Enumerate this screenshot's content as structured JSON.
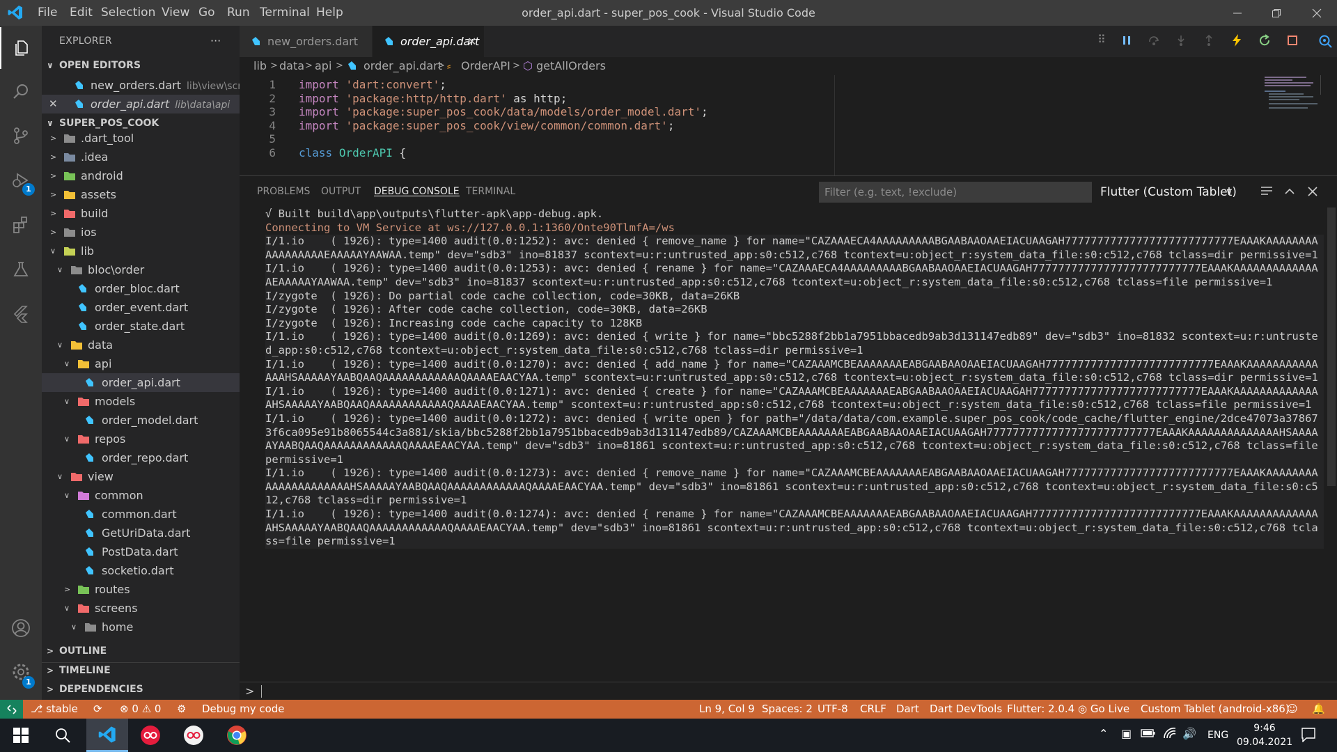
{
  "window": {
    "title": "order_api.dart - super_pos_cook - Visual Studio Code",
    "menu": [
      "File",
      "Edit",
      "Selection",
      "View",
      "Go",
      "Run",
      "Terminal",
      "Help"
    ]
  },
  "activity_bar": {
    "debug_badge": "1",
    "settings_badge": "1"
  },
  "sidebar": {
    "title": "EXPLORER",
    "more": "···",
    "open_editors_label": "OPEN EDITORS",
    "open_editors": [
      {
        "name": "new_orders.dart",
        "path": "lib\\view\\scr..."
      },
      {
        "name": "order_api.dart",
        "path": "lib\\data\\api"
      }
    ],
    "project_label": "SUPER_POS_COOK",
    "tree": [
      {
        "name": ".dart_tool"
      },
      {
        "name": ".idea"
      },
      {
        "name": "android"
      },
      {
        "name": "assets"
      },
      {
        "name": "build"
      },
      {
        "name": "ios"
      },
      {
        "name": "lib"
      },
      {
        "name": "bloc\\order"
      },
      {
        "name": "order_bloc.dart"
      },
      {
        "name": "order_event.dart"
      },
      {
        "name": "order_state.dart"
      },
      {
        "name": "data"
      },
      {
        "name": "api"
      },
      {
        "name": "order_api.dart"
      },
      {
        "name": "models"
      },
      {
        "name": "order_model.dart"
      },
      {
        "name": "repos"
      },
      {
        "name": "order_repo.dart"
      },
      {
        "name": "view"
      },
      {
        "name": "common"
      },
      {
        "name": "common.dart"
      },
      {
        "name": "GetUriData.dart"
      },
      {
        "name": "PostData.dart"
      },
      {
        "name": "socketio.dart"
      },
      {
        "name": "routes"
      },
      {
        "name": "screens"
      },
      {
        "name": "home"
      }
    ],
    "outline_label": "OUTLINE",
    "timeline_label": "TIMELINE",
    "dependencies_label": "DEPENDENCIES"
  },
  "tabs": [
    {
      "label": "new_orders.dart"
    },
    {
      "label": "order_api.dart"
    }
  ],
  "breadcrumb": [
    "lib",
    "data",
    "api",
    "order_api.dart",
    "OrderAPI",
    "getAllOrders"
  ],
  "editor": {
    "lines": [
      {
        "num": "1",
        "kw": "import",
        "str": "'dart:convert'",
        "rest": ";"
      },
      {
        "num": "2",
        "kw": "import",
        "str": "'package:http/http.dart'",
        "rest": " as http;"
      },
      {
        "num": "3",
        "kw": "import",
        "str": "'package:super_pos_cook/data/models/order_model.dart'",
        "rest": ";"
      },
      {
        "num": "4",
        "kw": "import",
        "str": "'package:super_pos_cook/view/common/common.dart'",
        "rest": ";"
      },
      {
        "num": "5",
        "kw": "",
        "str": "",
        "rest": ""
      },
      {
        "num": "6",
        "kw": "class",
        "str": "OrderAPI",
        "rest": " {"
      }
    ]
  },
  "panel": {
    "tabs": [
      "PROBLEMS",
      "OUTPUT",
      "DEBUG CONSOLE",
      "TERMINAL"
    ],
    "filter_placeholder": "Filter (e.g. text, !exclude)",
    "debug_target": "Flutter (Custom Tablet)",
    "prompt": ">",
    "console": [
      "√ Built build\\app\\outputs\\flutter-apk\\app-debug.apk.",
      "Connecting to VM Service at ws://127.0.0.1:1360/Onte90TlmfA=/ws",
      "I/1.io    ( 1926): type=1400 audit(0.0:1252): avc: denied { remove_name } for name=\"CAZAAAECA4AAAAAAAAABGAABAAOAAEIACUAAGAH77777777777777777777777777EAAAKAAAAAAAAAAAAAAAAAEAAAAAYAAWAA.temp\" dev=\"sdb3\" ino=81837 scontext=u:r:untrusted_app:s0:c512,c768 tcontext=u:object_r:system_data_file:s0:c512,c768 tclass=dir permissive=1",
      "I/1.io    ( 1926): type=1400 audit(0.0:1253): avc: denied { rename } for name=\"CAZAAAECA4AAAAAAAAABGAABAAOAAEIACUAAGAH77777777777777777777777777EAAAKAAAAAAAAAAAAAAEAAAAAYAAWAA.temp\" dev=\"sdb3\" ino=81837 scontext=u:r:untrusted_app:s0:c512,c768 tcontext=u:object_r:system_data_file:s0:c512,c768 tclass=file permissive=1",
      "I/zygote  ( 1926): Do partial code cache collection, code=30KB, data=26KB",
      "I/zygote  ( 1926): After code cache collection, code=30KB, data=26KB",
      "I/zygote  ( 1926): Increasing code cache capacity to 128KB",
      "I/1.io    ( 1926): type=1400 audit(0.0:1269): avc: denied { write } for name=\"bbc5288f2bb1a7951bbacedb9ab3d131147edb89\" dev=\"sdb3\" ino=81832 scontext=u:r:untrusted_app:s0:c512,c768 tcontext=u:object_r:system_data_file:s0:c512,c768 tclass=dir permissive=1",
      "I/1.io    ( 1926): type=1400 audit(0.0:1270): avc: denied { add_name } for name=\"CAZAAAMCBEAAAAAAAEABGAABAAOAAEIACUAAGAH77777777777777777777777777EAAAKAAAAAAAAAAAAAAHSAAAAAYAABQAAQAAAAAAAAAAAAQAAAAEAACYAA.temp\" scontext=u:r:untrusted_app:s0:c512,c768 tcontext=u:object_r:system_data_file:s0:c512,c768 tclass=dir permissive=1",
      "I/1.io    ( 1926): type=1400 audit(0.0:1271): avc: denied { create } for name=\"CAZAAAMCBEAAAAAAAEABGAABAAOAAEIACUAAGAH77777777777777777777777777EAAAKAAAAAAAAAAAAAAHSAAAAAYAABQAAQAAAAAAAAAAAAQAAAAEAACYAA.temp\" scontext=u:r:untrusted_app:s0:c512,c768 tcontext=u:object_r:system_data_file:s0:c512,c768 tclass=file permissive=1",
      "I/1.io    ( 1926): type=1400 audit(0.0:1272): avc: denied { write open } for path=\"/data/data/com.example.super_pos_cook/code_cache/flutter_engine/2dce47073a378673f6ca095e91b8065544c3a881/skia/bbc5288f2bb1a7951bbacedb9ab3d131147edb89/CAZAAAMCBEAAAAAAAEABGAABAAOAAEIACUAAGAH77777777777777777777777777EAAAKAAAAAAAAAAAAAAHSAAAAAYAABQAAQAAAAAAAAAAAAQAAAAEAACYAA.temp\" dev=\"sdb3\" ino=81861 scontext=u:r:untrusted_app:s0:c512,c768 tcontext=u:object_r:system_data_file:s0:c512,c768 tclass=file permissive=1",
      "I/1.io    ( 1926): type=1400 audit(0.0:1273): avc: denied { remove_name } for name=\"CAZAAAMCBEAAAAAAAEABGAABAAOAAEIACUAAGAH77777777777777777777777777EAAAKAAAAAAAAAAAAAAAAAAAAAHSAAAAAYAABQAAQAAAAAAAAAAAAQAAAAEAACYAA.temp\" dev=\"sdb3\" ino=81861 scontext=u:r:untrusted_app:s0:c512,c768 tcontext=u:object_r:system_data_file:s0:c512,c768 tclass=dir permissive=1",
      "I/1.io    ( 1926): type=1400 audit(0.0:1274): avc: denied { rename } for name=\"CAZAAAMCBEAAAAAAAEABGAABAAOAAEIACUAAGAH77777777777777777777777777EAAAKAAAAAAAAAAAAAAHSAAAAAYAABQAAQAAAAAAAAAAAAQAAAAEAACYAA.temp\" dev=\"sdb3\" ino=81861 scontext=u:r:untrusted_app:s0:c512,c768 tcontext=u:object_r:system_data_file:s0:c512,c768 tclass=file permissive=1"
    ]
  },
  "statusbar": {
    "branch": "stable",
    "errors": "0",
    "warnings": "0",
    "debug_label": "Debug my code",
    "position": "Ln 9, Col 9",
    "spaces": "Spaces: 2",
    "encoding": "UTF-8",
    "eol": "CRLF",
    "language": "Dart",
    "devtools": "Dart DevTools",
    "flutter": "Flutter: 2.0.4",
    "golive": "Go Live",
    "device": "Custom Tablet (android-x86)"
  },
  "taskbar": {
    "language": "ENG",
    "time": "9:46",
    "date": "09.04.2021"
  },
  "colors": {
    "accent": "#007acc",
    "statusbar": "#cc6633"
  }
}
